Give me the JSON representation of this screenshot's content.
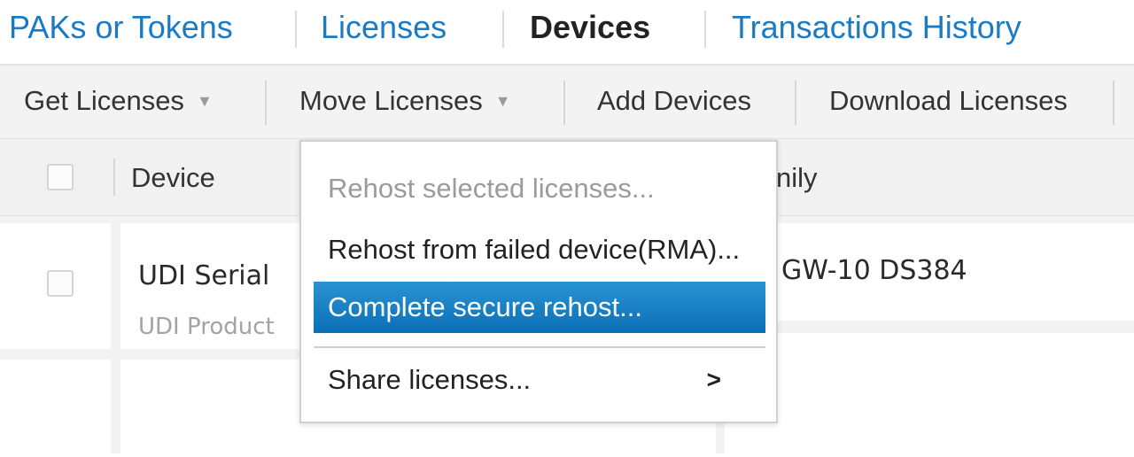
{
  "tabs": [
    {
      "label": "PAKs or Tokens"
    },
    {
      "label": "Licenses"
    },
    {
      "label": "Devices"
    },
    {
      "label": "Transactions History"
    }
  ],
  "toolbar": {
    "get_licenses": "Get Licenses",
    "move_licenses": "Move Licenses",
    "add_devices": "Add Devices",
    "download_licenses": "Download Licenses",
    "caret": "▼"
  },
  "table": {
    "header": {
      "device": "Device",
      "family": "nily"
    },
    "rows": [
      {
        "device_primary": "UDI Serial",
        "device_secondary": "UDI Product",
        "family": "GW-10 DS384"
      }
    ]
  },
  "menu": {
    "items": [
      {
        "label": "Rehost selected licenses...",
        "state": "disabled"
      },
      {
        "label": "Rehost from failed device(RMA)...",
        "state": "normal"
      },
      {
        "label": "Complete secure rehost...",
        "state": "highlighted"
      },
      {
        "label": "Share licenses...",
        "state": "normal",
        "submenu_arrow": ">"
      }
    ]
  },
  "colors": {
    "link_blue": "#1a7bc4",
    "menu_highlight": "#1680c7"
  },
  "icons": {
    "dropdown_caret": "caret-down-icon",
    "submenu": "chevron-right-icon"
  }
}
